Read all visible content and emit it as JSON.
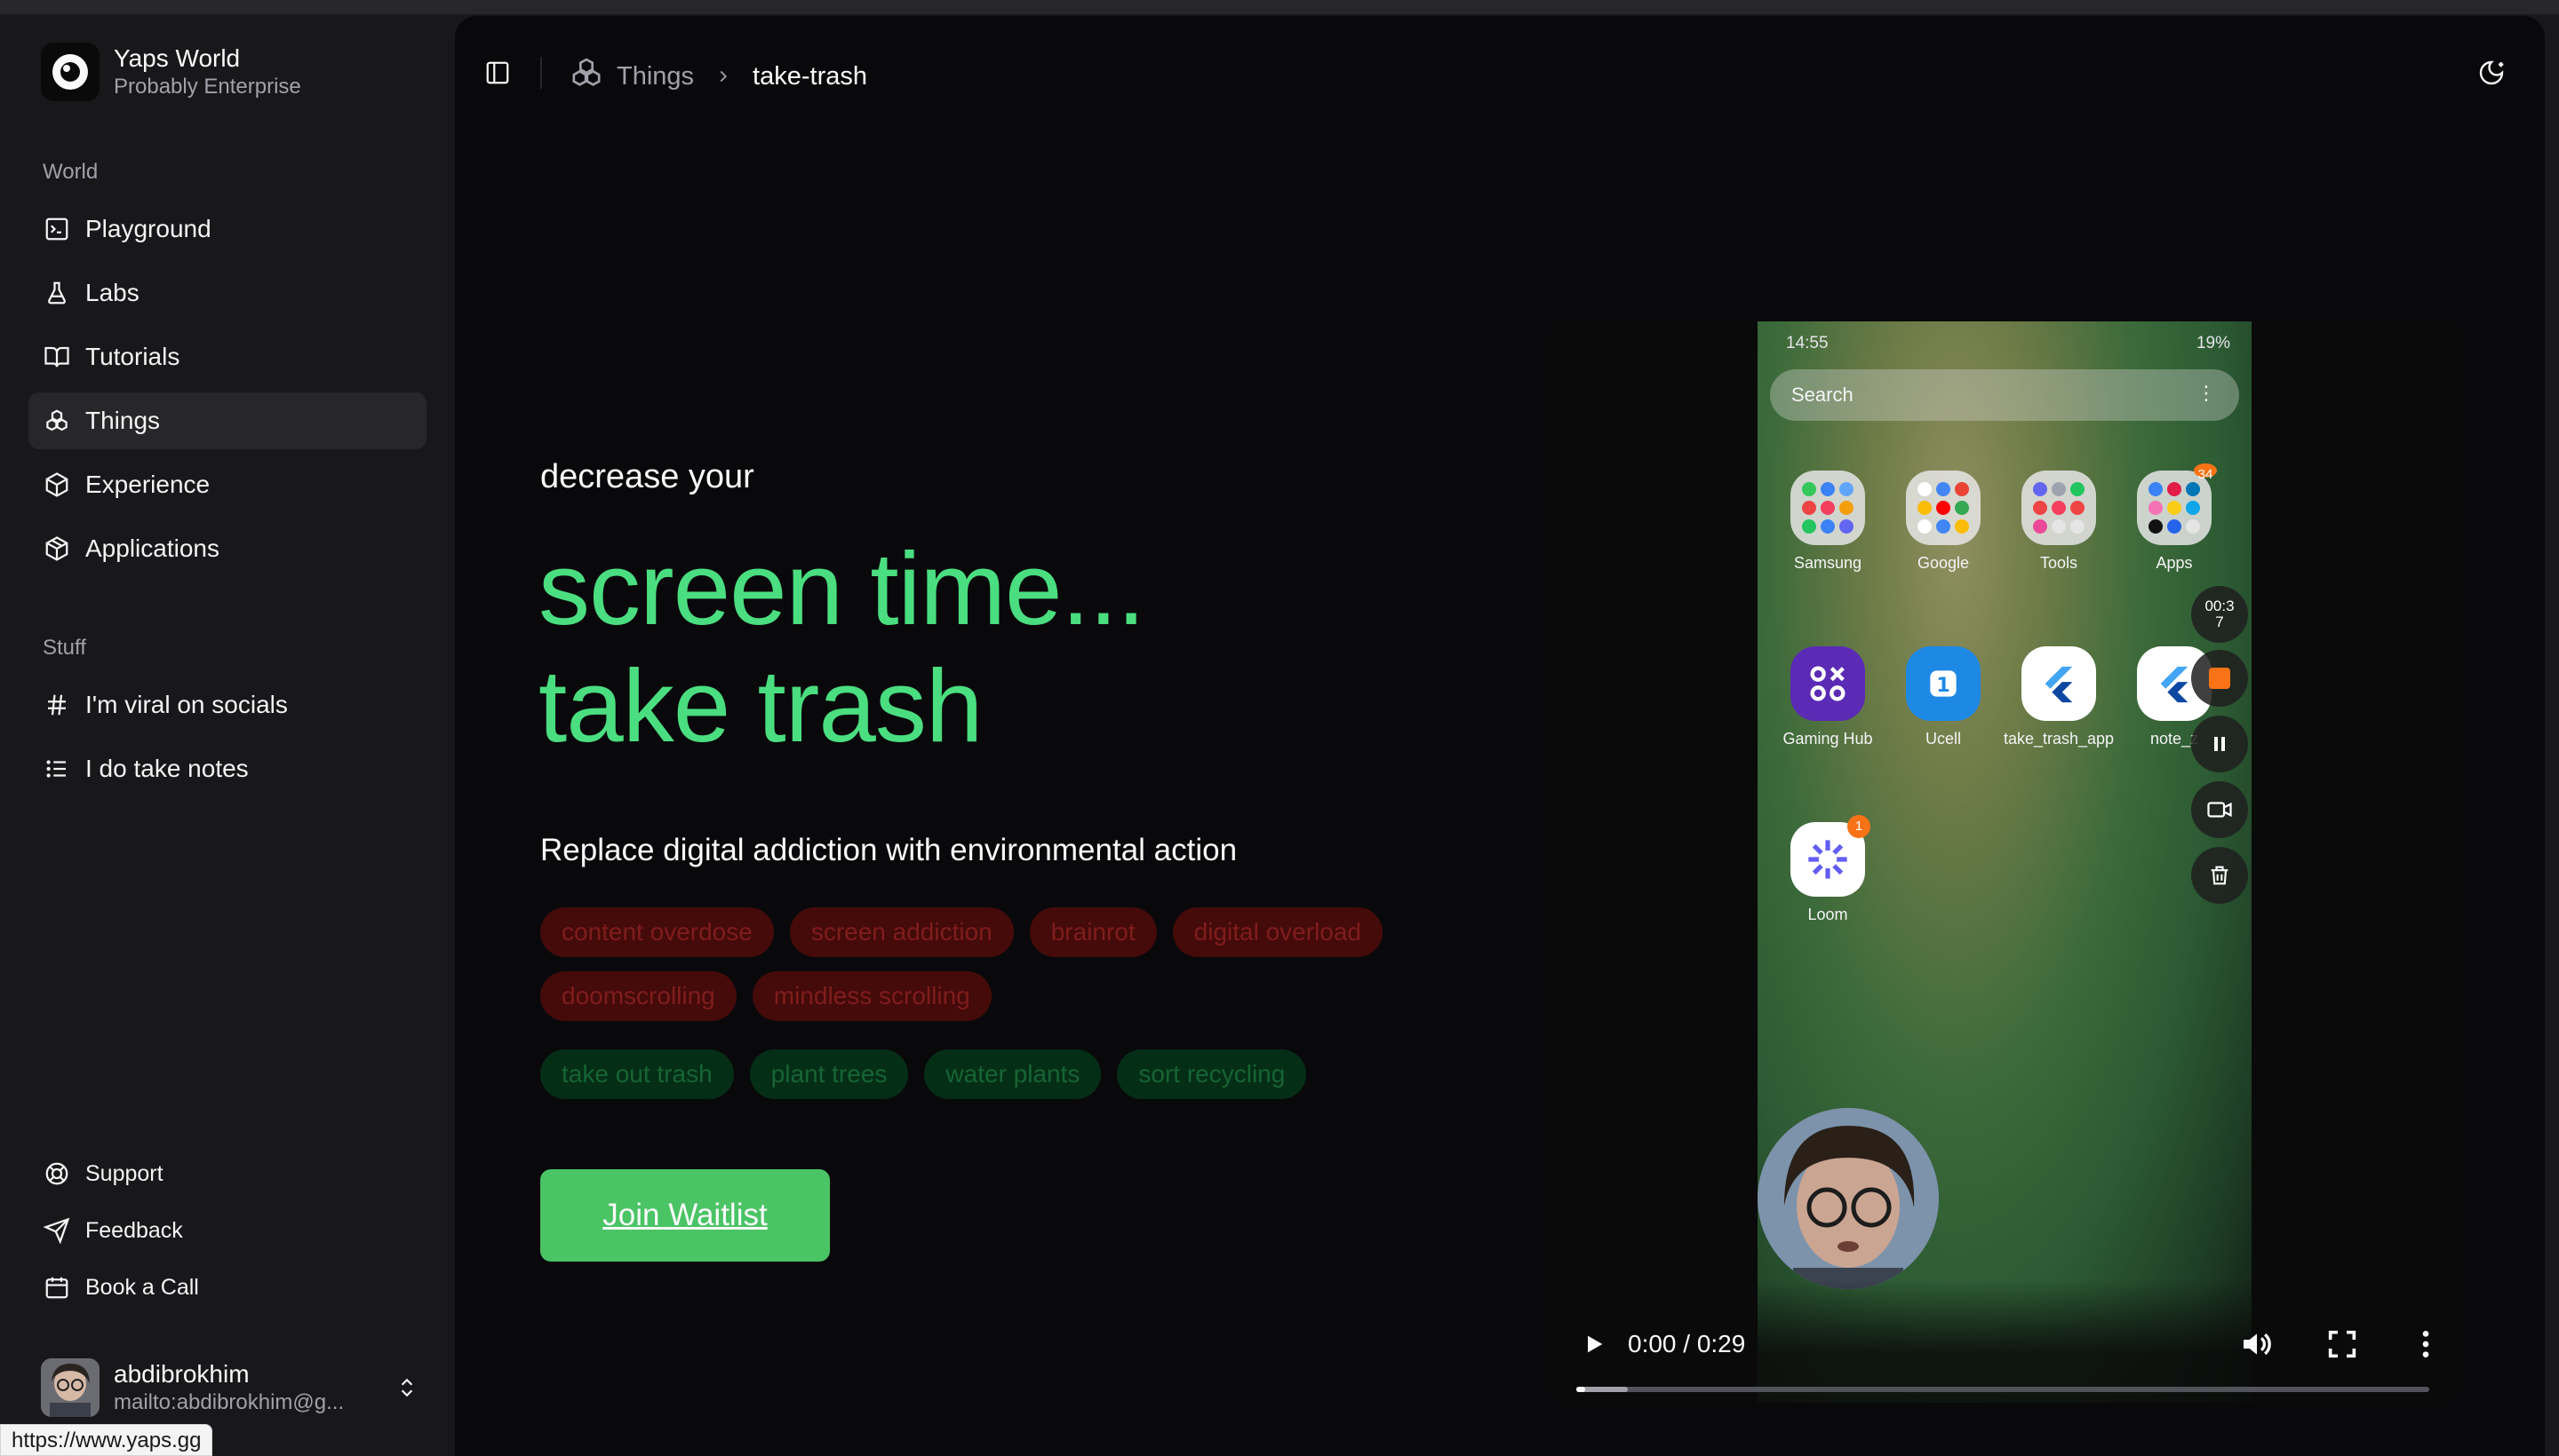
{
  "brand": {
    "name": "Yaps World",
    "subtitle": "Probably Enterprise"
  },
  "sidebar": {
    "group_world": "World",
    "world_items": [
      {
        "label": "Playground",
        "icon": "terminal-icon"
      },
      {
        "label": "Labs",
        "icon": "flask-icon"
      },
      {
        "label": "Tutorials",
        "icon": "book-open-icon"
      },
      {
        "label": "Things",
        "icon": "boxes-icon",
        "active": true
      },
      {
        "label": "Experience",
        "icon": "box-icon"
      },
      {
        "label": "Applications",
        "icon": "layers-icon"
      }
    ],
    "group_stuff": "Stuff",
    "stuff_items": [
      {
        "label": "I'm viral on socials",
        "icon": "hash-icon"
      },
      {
        "label": "I do take notes",
        "icon": "list-icon"
      }
    ],
    "footer_items": [
      {
        "label": "Support",
        "icon": "life-buoy-icon"
      },
      {
        "label": "Feedback",
        "icon": "send-icon"
      },
      {
        "label": "Book a Call",
        "icon": "calendar-icon"
      }
    ],
    "user": {
      "name": "abdibrokhim",
      "email": "mailto:abdibrokhim@g..."
    }
  },
  "status_url": "https://www.yaps.gg",
  "breadcrumb": {
    "parent": "Things",
    "current": "take-trash"
  },
  "hero": {
    "kicker": "decrease your",
    "line1": "screen time...",
    "line2": "take trash",
    "subtitle": "Replace digital addiction with environmental action",
    "bad_tags": [
      "content overdose",
      "screen addiction",
      "brainrot",
      "digital overload",
      "doomscrolling",
      "mindless scrolling"
    ],
    "good_tags": [
      "take out trash",
      "plant trees",
      "water plants",
      "sort recycling"
    ],
    "cta": "Join Waitlist"
  },
  "video": {
    "time": "0:00 / 0:29",
    "progress": 0.0,
    "buffered": 0.06,
    "phone": {
      "status_time": "14:55",
      "status_right": "19%",
      "search_placeholder": "Search",
      "apps": [
        {
          "label": "Samsung"
        },
        {
          "label": "Google"
        },
        {
          "label": "Tools"
        },
        {
          "label": "Apps",
          "badge": "34"
        },
        {
          "label": "Gaming Hub"
        },
        {
          "label": "Ucell"
        },
        {
          "label": "take_trash_app"
        },
        {
          "label": "note_z"
        },
        {
          "label": "Loom",
          "badge": "1"
        }
      ],
      "rec_timer": "00:3\n7"
    }
  },
  "colors": {
    "accent": "#4ade80",
    "cta": "#4ac465",
    "bad_tag_bg": "#450a0a",
    "good_tag_bg": "#052e16"
  }
}
